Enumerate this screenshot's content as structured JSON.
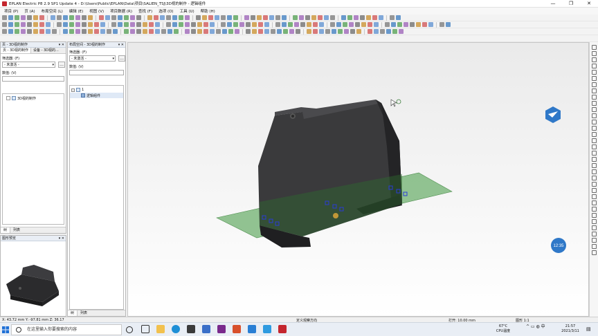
{
  "window": {
    "title": "EPLAN Electric P8 2.9 SP1 Update 4 - D:\\Users\\Public\\EPLAN\\Data\\项目\\SALIEN_TSJ\\3D视的制作 - 逻辑组件",
    "controls": [
      "—",
      "❐",
      "✕"
    ]
  },
  "menu": [
    "项目 (P)",
    "页 (A)",
    "布局空间 (L)",
    "编辑 (E)",
    "视图 (V)",
    "项目数据 (R)",
    "查找 (F)",
    "选项 (O)",
    "工具 (U)",
    "帮助 (H)"
  ],
  "colors": {
    "title_icon": "#c4262e",
    "accent": "#2f78c8",
    "plate": "#5fa85f",
    "housing": "#3a3a3c",
    "marker": "#2a3bd6"
  },
  "page_pane": {
    "header": "页 - 3D视的制作",
    "tabs": [
      "页 - 3D视的制作",
      "设备 - 3D视的..."
    ],
    "filter_label": "筛选器: (F)",
    "filter_value": "- 未激活 -",
    "value_label": "数值: (V)",
    "tree_item": "3D视的制作",
    "bottom_tabs": [
      "树",
      "列表"
    ]
  },
  "layout_pane": {
    "header": "布局空间 - 3D视的制作",
    "filter_label": "筛选器: (F)",
    "filter_value": "- 未激活 -",
    "value_label": "数值: (V)",
    "tree_root": "1",
    "tree_child": "逻辑组件",
    "bottom_tabs": [
      "树",
      "列表"
    ]
  },
  "preview_pane": {
    "header": "图形预览"
  },
  "viewport": {
    "badge_time": "12:35"
  },
  "statusbar": {
    "coords": "X: 43.72 mm   Y: -97.81 mm   Z: 36.17",
    "view_dir": "定义观察方向",
    "grid": "打开: 10.00 mm",
    "scale": "图形 1:1"
  },
  "taskbar": {
    "search_placeholder": "在这里输入你要搜索的内容",
    "weather": "67°C",
    "weather_sub": "CPU温度",
    "time": "21:57",
    "date": "2021/3/11"
  }
}
